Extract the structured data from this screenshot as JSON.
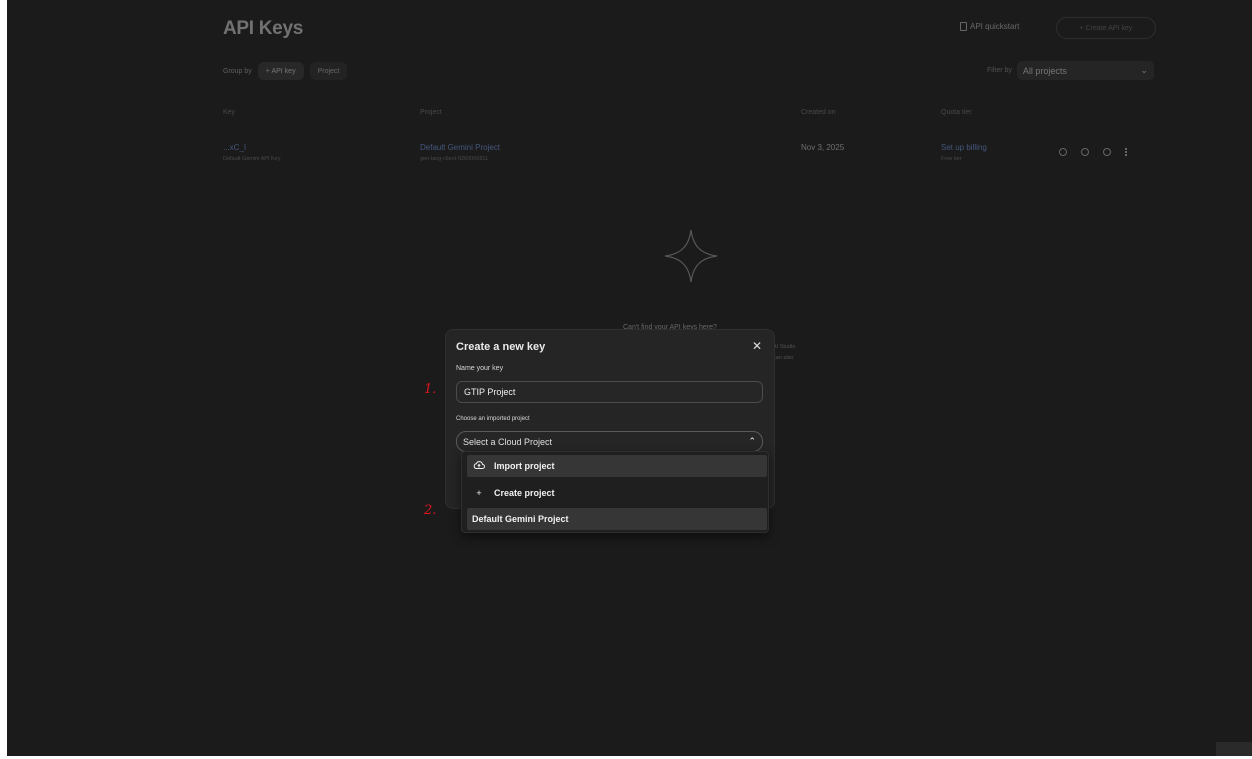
{
  "page": {
    "title": "API Keys",
    "quickstart_label": "API quickstart",
    "create_key_label": "+ Create API key",
    "group_by_label": "Group by",
    "group_by_options": [
      "+ API key",
      "Project"
    ],
    "filter_label": "Filter by",
    "filter_value": "All projects",
    "table_headers": [
      "Key",
      "Project",
      "Created on",
      "Quota tier"
    ],
    "row": {
      "key": "...xC_I",
      "key_name": "Default Gemini API Key",
      "project": "Default Gemini Project",
      "project_id": "gen-lang-client-0260000811",
      "created": "Nov 3, 2025",
      "quota": "Set up billing",
      "quota_tier": "Free tier"
    },
    "empty_heading": "Can't find your API keys here?",
    "empty_line1": "AI Studio.",
    "empty_line2": "can also"
  },
  "modal": {
    "title": "Create a new key",
    "close_icon": "close-icon",
    "name_label": "Name your key",
    "name_value": "GTIP Project",
    "project_label": "Choose an imported project",
    "project_placeholder": "Select a Cloud Project",
    "dropdown": [
      {
        "icon": "cloud-upload-icon",
        "label": "Import project"
      },
      {
        "icon": "plus-icon",
        "label": "Create project"
      },
      {
        "label": "Default Gemini Project"
      }
    ]
  },
  "annotations": [
    "1.",
    "2."
  ],
  "colors": {
    "background": "#1b1b1b",
    "modal": "#252525",
    "link": "#7aa7ff",
    "annotation": "#e0141e"
  }
}
